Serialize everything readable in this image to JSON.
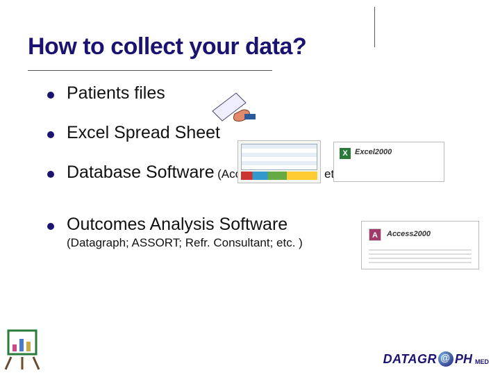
{
  "title": "How to collect your data?",
  "bullets": [
    {
      "main": "Patients files",
      "sub_inline": "",
      "sub_block": ""
    },
    {
      "main": "Excel Spread Sheet",
      "sub_inline": "",
      "sub_block": ""
    },
    {
      "main": "Database Software",
      "sub_inline": "(Access; Filemaker; etc. )",
      "sub_block": ""
    },
    {
      "main": "Outcomes Analysis Software",
      "sub_inline": "",
      "sub_block": "(Datagraph; ASSORT; Refr. Consultant; etc. )"
    }
  ],
  "thumbs": {
    "excel_box_label": "Excel2000",
    "excel_box_icon": "X",
    "access_box_label": "Access2000",
    "access_box_icon": "A"
  },
  "logo": {
    "part1": "DATAGR",
    "part2": "PH",
    "sub": "MED"
  }
}
